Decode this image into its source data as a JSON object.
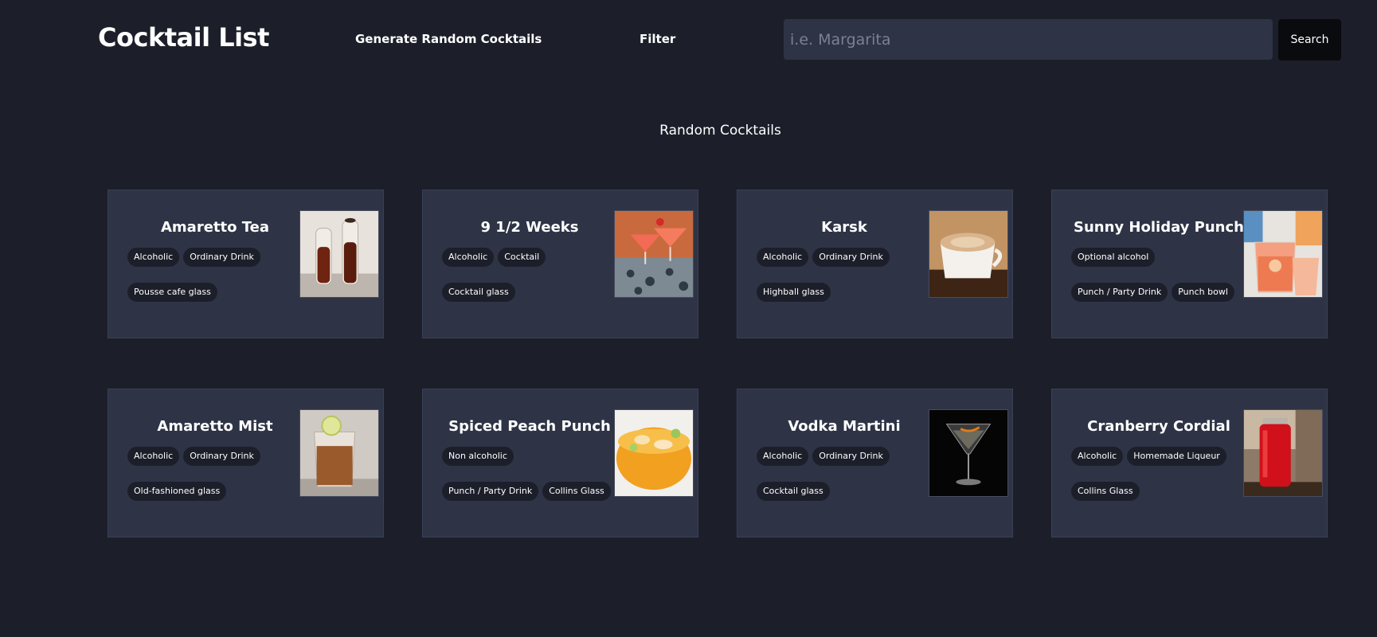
{
  "header": {
    "logo": "Cocktail List",
    "nav_random": "Generate Random Cocktails",
    "nav_filter": "Filter",
    "search_placeholder": "i.e. Margarita",
    "search_value": "",
    "search_button": "Search"
  },
  "main": {
    "section_title": "Random Cocktails"
  },
  "cards": [
    {
      "name": "Amaretto Tea",
      "tags": [
        "Alcoholic",
        "Ordinary Drink",
        "Pousse cafe glass"
      ],
      "image": "amaretto-tea-photo"
    },
    {
      "name": "9 1/2 Weeks",
      "tags": [
        "Alcoholic",
        "Cocktail",
        "Cocktail glass"
      ],
      "image": "nine-half-weeks-photo"
    },
    {
      "name": "Karsk",
      "tags": [
        "Alcoholic",
        "Ordinary Drink",
        "Highball glass"
      ],
      "image": "karsk-photo"
    },
    {
      "name": "Sunny Holiday Punch",
      "tags": [
        "Optional alcohol",
        "Punch / Party Drink",
        "Punch bowl"
      ],
      "image": "sunny-holiday-punch-photo"
    },
    {
      "name": "Amaretto Mist",
      "tags": [
        "Alcoholic",
        "Ordinary Drink",
        "Old-fashioned glass"
      ],
      "image": "amaretto-mist-photo"
    },
    {
      "name": "Spiced Peach Punch",
      "tags": [
        "Non alcoholic",
        "Punch / Party Drink",
        "Collins Glass"
      ],
      "image": "spiced-peach-punch-photo"
    },
    {
      "name": "Vodka Martini",
      "tags": [
        "Alcoholic",
        "Ordinary Drink",
        "Cocktail glass"
      ],
      "image": "vodka-martini-photo"
    },
    {
      "name": "Cranberry Cordial",
      "tags": [
        "Alcoholic",
        "Homemade Liqueur",
        "Collins Glass"
      ],
      "image": "cranberry-cordial-photo"
    }
  ],
  "colors": {
    "background": "#1c1f2a",
    "card": "#2e3446",
    "tag": "#1c1f2a",
    "button": "#0a0b0e",
    "text": "#ffffff"
  }
}
